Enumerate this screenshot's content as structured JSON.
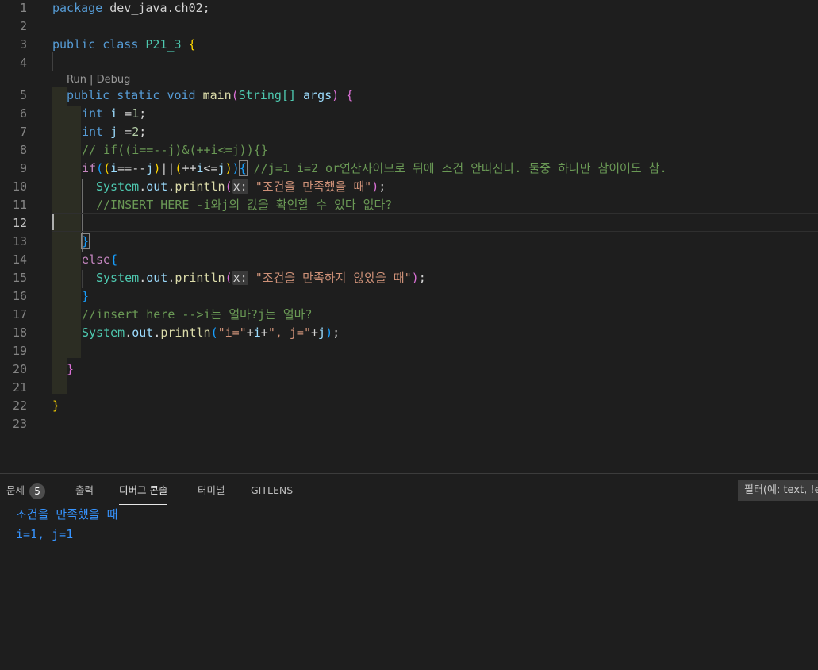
{
  "editor": {
    "line_numbers": [
      "1",
      "2",
      "3",
      "4",
      "5",
      "6",
      "7",
      "8",
      "9",
      "10",
      "11",
      "12",
      "13",
      "14",
      "15",
      "16",
      "17",
      "18",
      "19",
      "20",
      "21",
      "22",
      "23"
    ],
    "active_line": "12",
    "codelens": "Run | Debug",
    "code": {
      "l1": {
        "kw": "package",
        "rest": " dev_java.ch02;"
      },
      "l3": {
        "kw1": "public",
        "kw2": "class",
        "name": "P21_3",
        "brace": "{"
      },
      "l5": {
        "kw1": "public",
        "kw2": "static",
        "kw3": "void",
        "fn": "main",
        "open": "(",
        "type": "String[]",
        "arg": "args",
        "close": ")",
        "brace": "{"
      },
      "l6": {
        "kw": "int",
        "var": "i",
        "op": " =",
        "num": "1",
        "end": ";"
      },
      "l7": {
        "kw": "int",
        "var": "j",
        "op": " =",
        "num": "2",
        "end": ";"
      },
      "l8": {
        "comment": "// if((i==--j)&(++i<=j)){}"
      },
      "l9": {
        "kw": "if",
        "p1": "(",
        "p2": "(",
        "var1": "i",
        "op1": "==--",
        "var2": "j",
        "p3": ")",
        "or": "||",
        "p4": "(",
        "op2": "++",
        "var3": "i",
        "op3": "<=",
        "var4": "j",
        "p5": ")",
        "p6": ")",
        "brace": "{",
        "comment": " //j=1 i=2 or연산자이므로 뒤에 조건 안따진다. 둘중 하나만 참이어도 참."
      },
      "l10": {
        "type": "System",
        "dot1": ".",
        "field": "out",
        "dot2": ".",
        "fn": "println",
        "open": "(",
        "hint": "x:",
        "str": "\"조건을 만족했을 때\"",
        "close": ")",
        "end": ";"
      },
      "l11": {
        "comment": "//INSERT HERE -i와j의 값을 확인할 수 있다 없다?"
      },
      "l13": {
        "brace": "}"
      },
      "l14": {
        "kw": "else",
        "brace": "{"
      },
      "l15": {
        "type": "System",
        "dot1": ".",
        "field": "out",
        "dot2": ".",
        "fn": "println",
        "open": "(",
        "hint": "x:",
        "str": "\"조건을 만족하지 않았을 때\"",
        "close": ")",
        "end": ";"
      },
      "l16": {
        "brace": "}"
      },
      "l17": {
        "comment": "//insert here -->i는 얼마?j는 얼마?"
      },
      "l18": {
        "type": "System",
        "dot1": ".",
        "field": "out",
        "dot2": ".",
        "fn": "println",
        "open": "(",
        "str1": "\"i=\"",
        "op1": "+",
        "var1": "i",
        "op2": "+",
        "str2": "\", j=\"",
        "op3": "+",
        "var2": "j",
        "close": ")",
        "end": ";"
      },
      "l20": {
        "brace": "}"
      },
      "l22": {
        "brace": "}"
      }
    }
  },
  "panel": {
    "tabs": [
      {
        "label": "문제",
        "badge": "5"
      },
      {
        "label": "출력"
      },
      {
        "label": "디버그 콘솔",
        "active": true
      },
      {
        "label": "터미널"
      },
      {
        "label": "GITLENS"
      }
    ],
    "filter_placeholder": "필터(예: text, !exclude)",
    "filter_visible": "필터(예: text, !e",
    "console": [
      "조건을 만족했을 때",
      "i=1, j=1"
    ]
  },
  "colors": {
    "background": "#1e1e1e",
    "keyword": "#569cd6",
    "type": "#4ec9b0",
    "function": "#dcdcaa",
    "variable": "#9cdcfe",
    "string": "#ce9178",
    "comment": "#6a9955",
    "console_text": "#3794ff"
  }
}
